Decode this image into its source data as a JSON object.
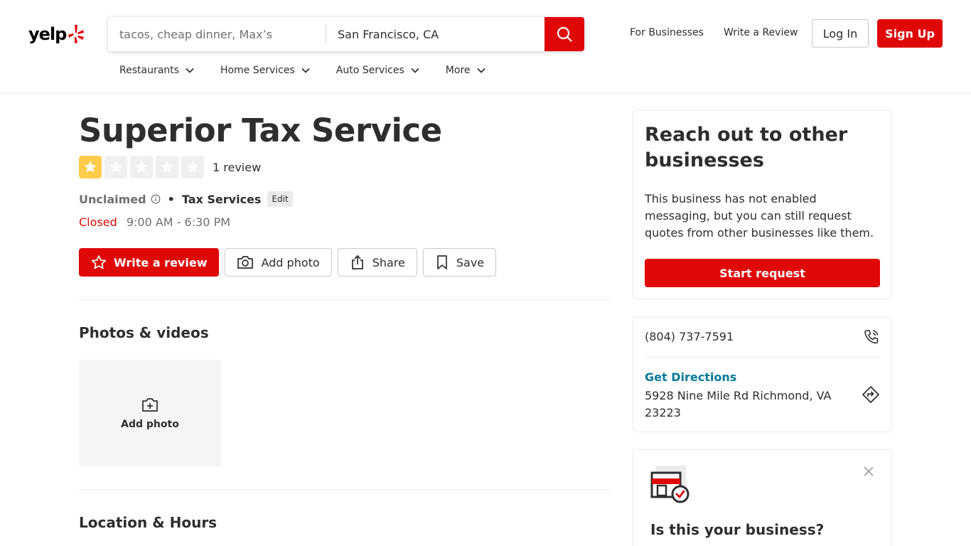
{
  "header": {
    "logo_text": "yelp",
    "search_find_placeholder": "tacos, cheap dinner, Max’s",
    "search_near_value": "San Francisco, CA",
    "for_businesses": "For Businesses",
    "write_review": "Write a Review",
    "login": "Log In",
    "signup": "Sign Up",
    "categories": [
      "Restaurants",
      "Home Services",
      "Auto Services",
      "More"
    ]
  },
  "business": {
    "name": "Superior Tax Service",
    "rating": 1,
    "rating_max": 5,
    "review_count": "1 review",
    "claim_status": "Unclaimed",
    "separator": "•",
    "category": "Tax Services",
    "edit_label": "Edit",
    "status": "Closed",
    "hours": "9:00 AM - 6:30 PM"
  },
  "actions": {
    "write_review": "Write a review",
    "add_photo": "Add photo",
    "share": "Share",
    "save": "Save"
  },
  "sections": {
    "photos_title": "Photos & videos",
    "add_photo_tile": "Add photo",
    "location_title": "Location & Hours"
  },
  "sidebar": {
    "reach_title": "Reach out to other businesses",
    "reach_desc": "This business has not enabled messaging, but you can still request quotes from other businesses like them.",
    "start_request": "Start request",
    "phone": "(804) 737-7591",
    "get_directions": "Get Directions",
    "address": "5928 Nine Mile Rd Richmond, VA 23223",
    "claim_title": "Is this your business?"
  },
  "colors": {
    "brand_red": "#e00707",
    "star_gold": "#ffcc4b",
    "link_teal": "#027a97"
  },
  "icons": [
    "yelp-burst-icon",
    "search-icon",
    "chevron-down-icon",
    "star-icon",
    "info-icon",
    "camera-icon",
    "share-icon",
    "bookmark-icon",
    "add-photo-icon",
    "phone-icon",
    "directions-icon",
    "storefront-icon",
    "close-icon"
  ]
}
